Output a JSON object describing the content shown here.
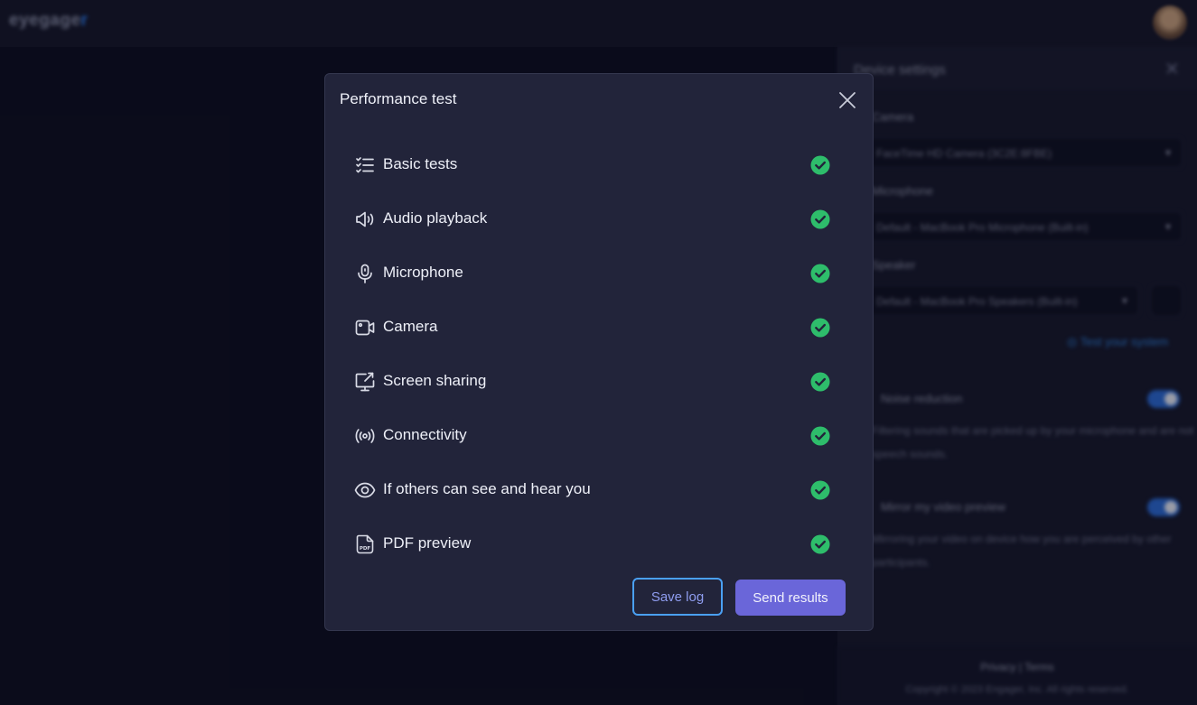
{
  "app": {
    "logo_text": "eyegage",
    "logo_suffix": "r"
  },
  "side_panel": {
    "title": "Device settings",
    "camera_label": "Camera",
    "camera_value": "FaceTime HD Camera (3C2E:8FBE)",
    "microphone_label": "Microphone",
    "microphone_value": "Default - MacBook Pro Microphone (Built-in)",
    "speaker_label": "Speaker",
    "speaker_value": "Default - MacBook Pro Speakers (Built-in)",
    "test_link": "Test your system",
    "noise_label": "Noise reduction",
    "noise_desc": "Filtering sounds that are picked up by your microphone and are not speech sounds.",
    "mirror_label": "Mirror my video preview",
    "mirror_desc": "Mirroring your video on device how you are perceived by other participants.",
    "footer_links": "Privacy | Terms",
    "footer_copy": "Copyright © 2023 Engager, Inc. All rights reserved."
  },
  "modal": {
    "title": "Performance test",
    "tests": [
      {
        "label": "Basic tests",
        "icon": "checklist-icon",
        "status": "passed"
      },
      {
        "label": "Audio playback",
        "icon": "speaker-icon",
        "status": "passed"
      },
      {
        "label": "Microphone",
        "icon": "microphone-icon",
        "status": "passed"
      },
      {
        "label": "Camera",
        "icon": "camera-icon",
        "status": "passed"
      },
      {
        "label": "Screen sharing",
        "icon": "screen-share-icon",
        "status": "passed"
      },
      {
        "label": "Connectivity",
        "icon": "signal-icon",
        "status": "passed"
      },
      {
        "label": "If others can see and hear you",
        "icon": "eye-icon",
        "status": "passed"
      },
      {
        "label": "PDF preview",
        "icon": "pdf-file-icon",
        "status": "passed"
      }
    ],
    "save_button": "Save log",
    "send_button": "Send results"
  },
  "colors": {
    "success": "#2ebd6b",
    "primary": "#6a66d9",
    "focus_outline": "#4aa0f4",
    "modal_bg": "#22243a"
  }
}
